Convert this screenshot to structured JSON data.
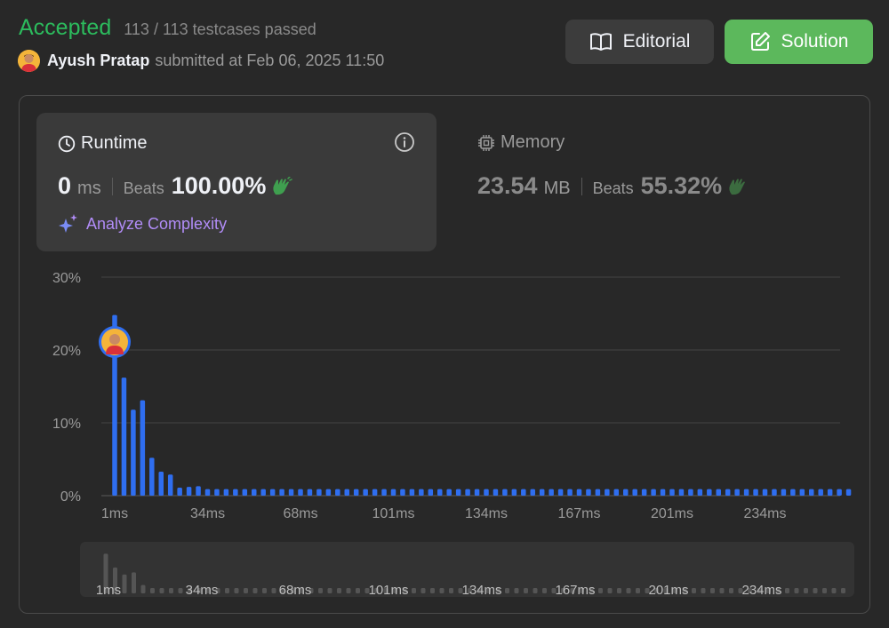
{
  "header": {
    "status": "Accepted",
    "testcases": "113 / 113 testcases passed",
    "user": "Ayush Pratap",
    "submitted": "submitted at Feb 06, 2025 11:50",
    "editorial_label": "Editorial",
    "solution_label": "Solution"
  },
  "runtime": {
    "title": "Runtime",
    "value": "0",
    "unit": "ms",
    "beats_label": "Beats",
    "beats": "100.00%",
    "analyze": "Analyze Complexity"
  },
  "memory": {
    "title": "Memory",
    "value": "23.54",
    "unit": "MB",
    "beats_label": "Beats",
    "beats": "55.32%"
  },
  "colors": {
    "accepted": "#2cbb5d",
    "bar": "#2f6ef0",
    "solution_button": "#5cb85c",
    "analyze": "#b18cf7"
  },
  "chart_data": {
    "type": "bar",
    "ylabel_ticks": [
      "30%",
      "20%",
      "10%",
      "0%"
    ],
    "yticks": [
      30,
      20,
      10,
      0
    ],
    "ylim": [
      0,
      30
    ],
    "xtick_labels": [
      "1ms",
      "34ms",
      "68ms",
      "101ms",
      "134ms",
      "167ms",
      "201ms",
      "234ms"
    ],
    "xtick_index": [
      0,
      10,
      20,
      30,
      40,
      50,
      60,
      70
    ],
    "grid": true,
    "values": [
      24.8,
      16.2,
      11.8,
      13.1,
      5.2,
      3.3,
      2.9,
      1.1,
      1.2,
      1.3,
      0.9,
      0.9,
      0.9,
      0.9,
      0.9,
      0.9,
      0.9,
      0.9,
      0.9,
      0.9,
      0.9,
      0.9,
      0.9,
      0.9,
      0.9,
      0.9,
      0.9,
      0.9,
      0.9,
      0.9,
      0.9,
      0.9,
      0.9,
      0.9,
      0.9,
      0.9,
      0.9,
      0.9,
      0.9,
      0.9,
      0.9,
      0.9,
      0.9,
      0.9,
      0.9,
      0.9,
      0.9,
      0.9,
      0.9,
      0.9,
      0.9,
      0.9,
      0.9,
      0.9,
      0.9,
      0.9,
      0.9,
      0.9,
      0.9,
      0.9,
      0.9,
      0.9,
      0.9,
      0.9,
      0.9,
      0.9,
      0.9,
      0.9,
      0.9,
      0.9,
      0.9,
      0.9,
      0.9,
      0.9,
      0.9,
      0.9,
      0.9,
      0.9,
      0.9,
      0.9
    ],
    "highlight_index": 0
  }
}
